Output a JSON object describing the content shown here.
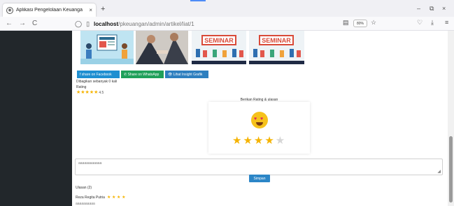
{
  "browser": {
    "tab_title": "Aplikasi Pengelolaan Keuanga",
    "tab_close": "×",
    "new_tab": "+",
    "url_host": "localhost",
    "url_path": "/pkeuangan/admin/artikel/liat/1",
    "zoom": "80%",
    "back_icon": "←",
    "forward_icon": "→",
    "reload_icon": "C",
    "minimize": "–",
    "maximize": "⧉",
    "close": "×"
  },
  "thumbnails": {
    "seminar_label_1": "SEMINAR",
    "seminar_label_2": "SEMINAR"
  },
  "share": {
    "facebook": "f share on Facebook",
    "whatsapp": "✆ Share on WhatsApp",
    "insight": "👁 Lihat Insight Grafik"
  },
  "article": {
    "shared_text": "Dibagikan sebanyak 0 kali",
    "rating_label": "Rating",
    "rating_stars": "★★★★★",
    "rating_value": "4.5"
  },
  "rate_card": {
    "title": "Berikan Rating & ulasan",
    "emoji": "love-eyes",
    "selected_stars": 4,
    "total_stars": 5,
    "stars_on": "★★★★",
    "stars_off": "★"
  },
  "comment": {
    "typed_text": "aaaaaaaaaaaa",
    "save_label": "Simpan"
  },
  "reviews": {
    "header": "Ulasan (2)",
    "first_name": "Reza Regita Putria",
    "first_stars": "★ ★ ★ ★",
    "first_text": "aaaaaaaaaa"
  },
  "colors": {
    "sidebar": "#22272b",
    "facebook": "#1f8fd1",
    "whatsapp": "#20a05a",
    "star": "#f5b301",
    "save": "#2c86c7"
  }
}
